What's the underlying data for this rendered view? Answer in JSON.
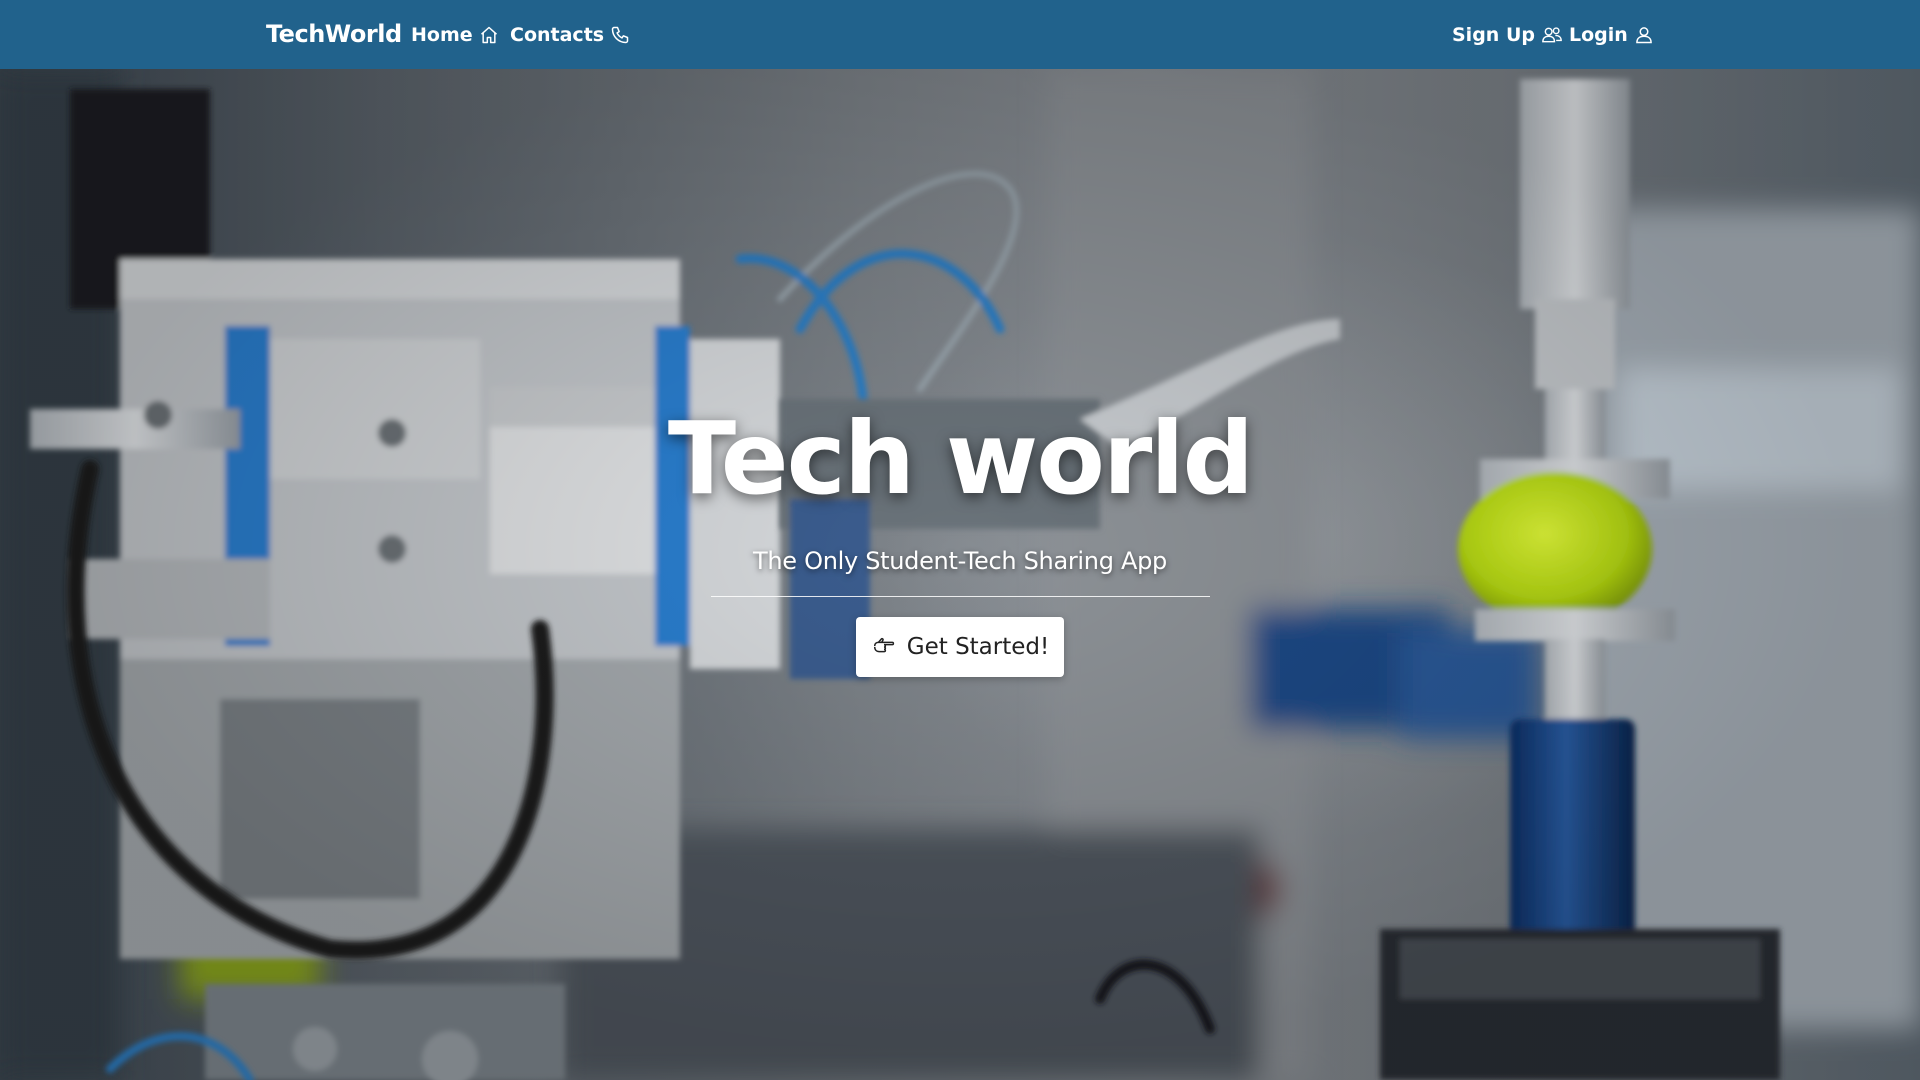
{
  "navbar": {
    "brand": "TechWorld",
    "links": [
      {
        "label": "Home",
        "icon": "home-icon"
      },
      {
        "label": "Contacts",
        "icon": "phone-icon"
      }
    ],
    "right_links": [
      {
        "label": "Sign Up",
        "icon": "users-icon"
      },
      {
        "label": "Login",
        "icon": "user-icon"
      }
    ],
    "color": "#21628c"
  },
  "hero": {
    "title": "Tech world",
    "subtitle": "The Only Student-Tech Sharing App",
    "cta_label": "Get Started!",
    "cta_icon": "hand-pointer-icon",
    "background_image": "blurred industrial machine with blue pneumatic parts and a yellow tennis ball"
  }
}
